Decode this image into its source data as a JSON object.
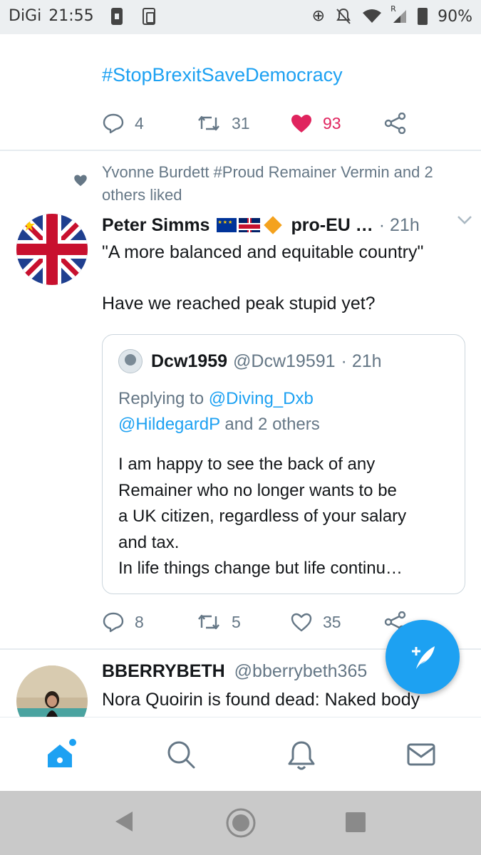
{
  "status_bar": {
    "carrier": "DiGi",
    "time": "21:55",
    "battery": "90%",
    "signal_label": "R"
  },
  "previous_tweet": {
    "hashtag": "#StopBrexitSaveDemocracy",
    "replies": "4",
    "retweets": "31",
    "likes": "93",
    "liked": true
  },
  "tweet": {
    "social_context": "Yvonne Burdett #Proud Remainer Vermin and 2 others liked",
    "author_name": "Peter Simms",
    "author_suffix": "pro-EU …",
    "time": "· 21h",
    "text_line1": "\"A more balanced and equitable country\"",
    "text_line2": "Have we reached peak stupid yet?",
    "replies": "8",
    "retweets": "5",
    "likes": "35",
    "quoted": {
      "name": "Dcw1959",
      "handle": "@Dcw19591",
      "time": "· 21h",
      "replying_prefix": "Replying to",
      "replying_mention1": "@Diving_Dxb",
      "replying_mention2": "@HildegardP",
      "replying_suffix": "and 2 others",
      "lines": [
        "I am happy to see the back of any",
        "Remainer who no longer wants to be",
        "a UK citizen, regardless of your salary",
        "and tax.",
        "In life things change but life continu…"
      ]
    }
  },
  "next_tweet": {
    "author_name": "BBERRYBETH",
    "handle": "@bberrybeth365",
    "text": "Nora Quoirin is found dead: Naked body"
  },
  "tabs": [
    {
      "name": "home-icon",
      "active": true
    },
    {
      "name": "search-icon",
      "active": false
    },
    {
      "name": "notifications-icon",
      "active": false
    },
    {
      "name": "messages-icon",
      "active": false
    }
  ],
  "colors": {
    "accent": "#1da1f2",
    "like": "#e0245e",
    "muted": "#657786"
  }
}
